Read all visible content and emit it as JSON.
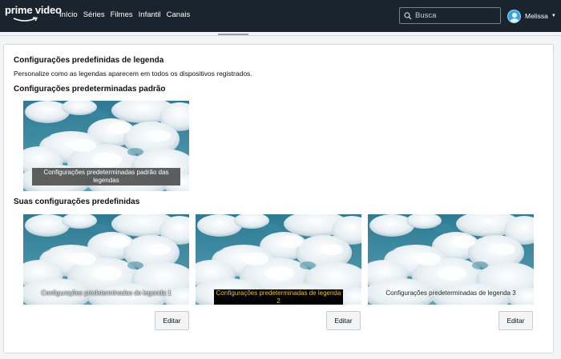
{
  "app": {
    "logo_text": "prime video"
  },
  "nav": {
    "links": [
      "Início",
      "Séries",
      "Filmes",
      "Infantil",
      "Canais"
    ]
  },
  "search": {
    "placeholder": "Busca"
  },
  "profile": {
    "name": "Melissa"
  },
  "page": {
    "title": "Configurações predefinidas de legenda",
    "subtitle": "Personalize como as legendas aparecem em todos os dispositivos registrados.",
    "default_section_title": "Configurações predeterminadas padrão",
    "default_preset": {
      "caption": "Configurações predeterminadas padrão das legendas"
    },
    "custom_section_title": "Suas configurações predefinidas",
    "custom_presets": [
      {
        "caption": "Configurações predeterminadas de legenda 1",
        "edit_label": "Editar",
        "caption_color": "#ffffff",
        "caption_bg": "transparent"
      },
      {
        "caption": "Configurações predeterminadas de legenda 2",
        "edit_label": "Editar",
        "caption_color": "#f0c419",
        "caption_bg": "#000000"
      },
      {
        "caption": "Configurações predeterminadas de legenda 3",
        "edit_label": "Editar",
        "caption_color": "#1a1a1a",
        "caption_bg": "transparent"
      }
    ]
  },
  "colors": {
    "nav_bg": "#1a242f",
    "page_bg": "#f2f4f5",
    "accent": "#3aa3dc"
  }
}
